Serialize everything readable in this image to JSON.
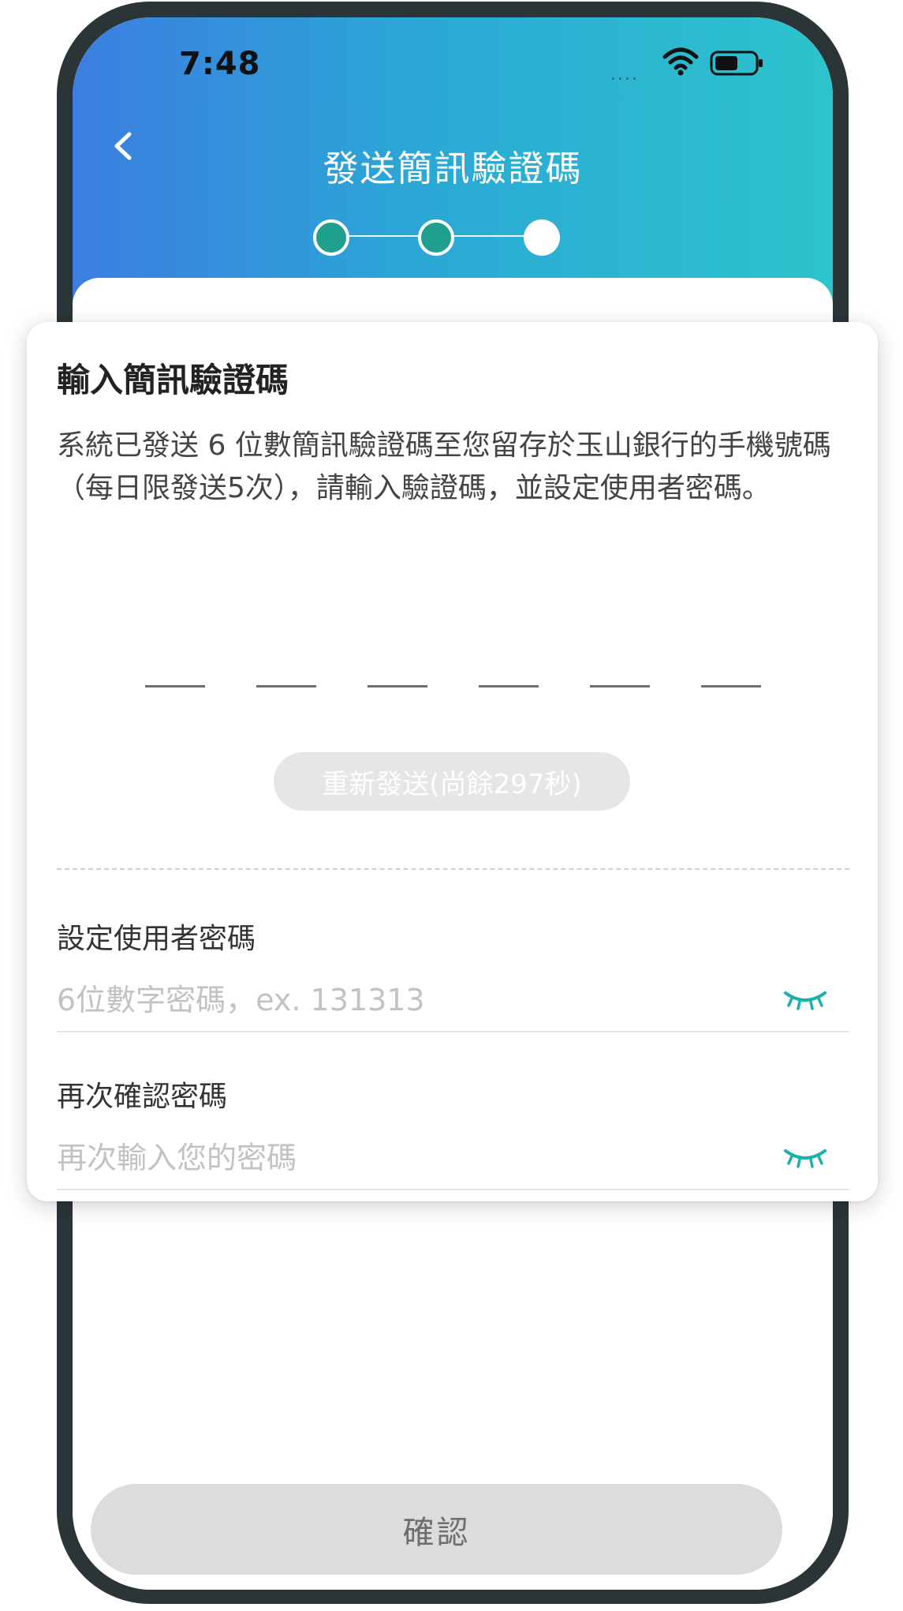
{
  "status_bar": {
    "time": "7:48",
    "signal_dots": "....",
    "wifi_icon": "wifi-icon",
    "battery_icon": "battery-icon"
  },
  "nav": {
    "back_icon": "chevron-left-icon",
    "title": "發送簡訊驗證碼"
  },
  "stepper": {
    "total_steps": 3,
    "current_step": 3,
    "completed_color": "#1fa08e",
    "current_color": "#ffffff"
  },
  "card": {
    "title": "輸入簡訊驗證碼",
    "description": "系統已發送 6 位數簡訊驗證碼至您留存於玉山銀行的手機號碼（每日限發送5次），請輸入驗證碼，並設定使用者密碼。",
    "otp": {
      "length": 6,
      "value": ""
    },
    "resend_label": "重新發送(尚餘297秒)",
    "password": {
      "label": "設定使用者密碼",
      "placeholder": "6位數字密碼，ex. 131313",
      "value": "",
      "eye_icon": "eye-closed-icon"
    },
    "confirm_password": {
      "label": "再次確認密碼",
      "placeholder": "再次輸入您的密碼",
      "value": "",
      "eye_icon": "eye-closed-icon"
    }
  },
  "footer": {
    "confirm_label": "確認"
  },
  "colors": {
    "header_gradient_start": "#3b7ee0",
    "header_gradient_end": "#2cc4cc",
    "accent": "#1fa08e",
    "eye_icon": "#17b3a8",
    "disabled_button": "#dcdcdc"
  }
}
